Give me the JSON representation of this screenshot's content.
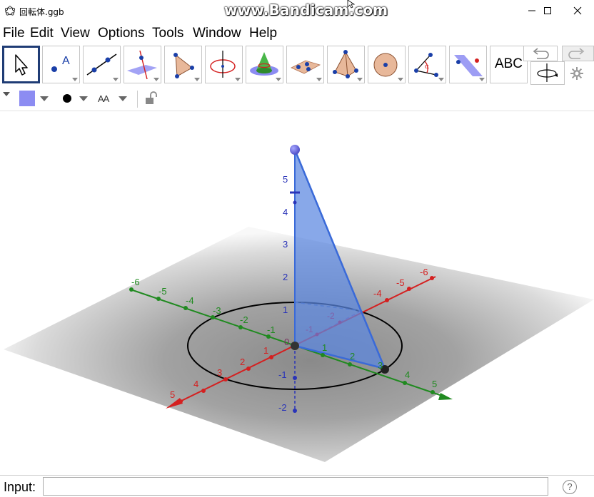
{
  "window": {
    "title": "回転体.ggb",
    "watermark": "www.Bandicam.com"
  },
  "menu": [
    "File",
    "Edit",
    "View",
    "Options",
    "Tools",
    "Window",
    "Help"
  ],
  "toolbar": {
    "tools": [
      {
        "name": "move-tool",
        "icon": "arrow-cursor-icon"
      },
      {
        "name": "point-tool",
        "icon": "point-icon",
        "label": "A"
      },
      {
        "name": "line-tool",
        "icon": "line-icon"
      },
      {
        "name": "perpendicular-line-tool",
        "icon": "perpendicular-icon"
      },
      {
        "name": "polygon-tool",
        "icon": "polygon-icon"
      },
      {
        "name": "circle-tool",
        "icon": "circle-axis-icon"
      },
      {
        "name": "cone-tool",
        "icon": "cone-icon"
      },
      {
        "name": "plane-tool",
        "icon": "plane-icon"
      },
      {
        "name": "pyramid-tool",
        "icon": "pyramid-icon"
      },
      {
        "name": "sphere-tool",
        "icon": "sphere-icon"
      },
      {
        "name": "angle-tool",
        "icon": "angle-icon",
        "label": "α"
      },
      {
        "name": "reflect-tool",
        "icon": "reflect-icon"
      },
      {
        "name": "text-tool",
        "icon": "text-icon",
        "label": "ABC"
      },
      {
        "name": "rotate-view-tool",
        "icon": "rotate-view-icon"
      }
    ],
    "undo_icon": "undo-icon",
    "redo_icon": "redo-icon",
    "settings_icon": "gear-icon"
  },
  "stylebar": {
    "text_size_label": "AA",
    "color": "#8c8cf2"
  },
  "graphics": {
    "z_ticks": [
      "5",
      "4",
      "3",
      "2",
      "1",
      "-1",
      "-2"
    ],
    "x_ticks_pos": [
      "1",
      "2",
      "3",
      "4",
      "5"
    ],
    "x_ticks_neg": [
      "-4",
      "-5",
      "-6"
    ],
    "y_ticks_pos": [
      "1",
      "2",
      "3",
      "4",
      "5"
    ],
    "y_ticks_neg": [
      "-1",
      "-2",
      "-3",
      "-4",
      "-5",
      "-6"
    ],
    "origin_label": "0",
    "inner_labels": [
      "-1",
      "-2"
    ],
    "colors": {
      "x_axis": "#d42020",
      "y_axis": "#208a20",
      "z_axis": "#2a34b8",
      "triangle": "#5a86e0"
    }
  },
  "input": {
    "label": "Input:",
    "value": "",
    "help": "?"
  }
}
